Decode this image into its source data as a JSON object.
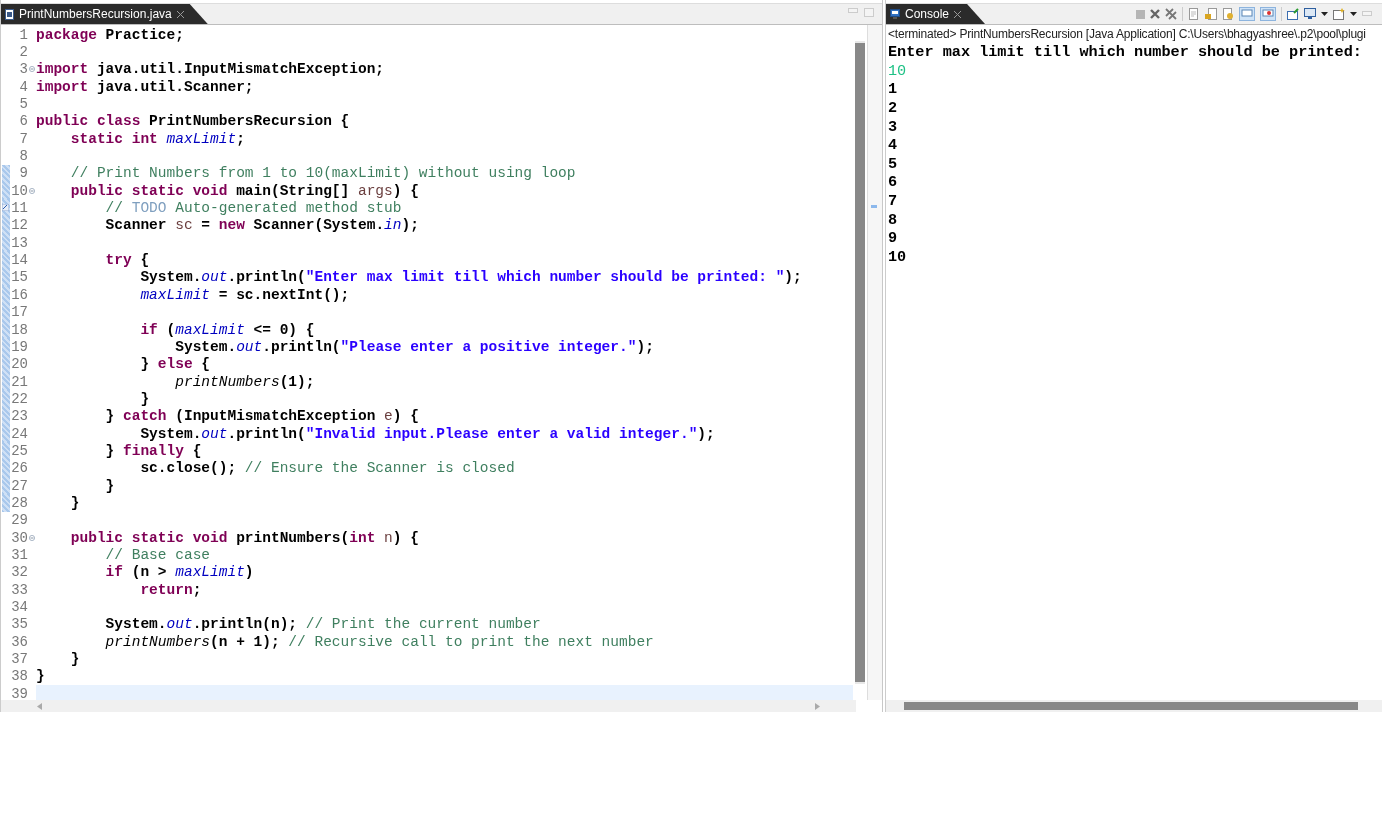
{
  "editor": {
    "tab": {
      "label": "PrintNumbersRecursion.java",
      "selected": true
    },
    "lines": [
      {
        "number": "1",
        "fold": false,
        "changed": false,
        "task": false,
        "current": false,
        "tokens": [
          {
            "kind": "keyword",
            "text": "package"
          },
          {
            "kind": "plain",
            "text": " Practice;"
          }
        ]
      },
      {
        "number": "2",
        "fold": false,
        "changed": false,
        "task": false,
        "current": false
      },
      {
        "number": "3",
        "fold": true,
        "changed": false,
        "task": false,
        "current": false,
        "tokens": [
          {
            "kind": "keyword",
            "text": "import"
          },
          {
            "kind": "plain",
            "text": " java.util.InputMismatchException;"
          }
        ]
      },
      {
        "number": "4",
        "fold": false,
        "changed": false,
        "task": false,
        "current": false,
        "tokens": [
          {
            "kind": "keyword",
            "text": "import"
          },
          {
            "kind": "plain",
            "text": " java.util.Scanner;"
          }
        ]
      },
      {
        "number": "5",
        "fold": false,
        "changed": false,
        "task": false,
        "current": false
      },
      {
        "number": "6",
        "fold": false,
        "changed": false,
        "task": false,
        "current": false,
        "tokens": [
          {
            "kind": "keyword",
            "text": "public class"
          },
          {
            "kind": "plain",
            "text": " PrintNumbersRecursion {"
          }
        ]
      },
      {
        "number": "7",
        "fold": false,
        "changed": false,
        "task": false,
        "current": false,
        "tokens": [
          {
            "kind": "keyword",
            "text": "    static int "
          },
          {
            "kind": "field",
            "text": "maxLimit"
          },
          {
            "kind": "plain",
            "text": ";"
          }
        ]
      },
      {
        "number": "8",
        "fold": false,
        "changed": false,
        "task": false,
        "current": false
      },
      {
        "number": "9",
        "fold": false,
        "changed": true,
        "task": false,
        "current": false,
        "tokens": [
          {
            "kind": "comment",
            "text": "    // Print Numbers from 1 to 10(maxLimit) without using loop"
          }
        ]
      },
      {
        "number": "10",
        "fold": true,
        "changed": true,
        "task": false,
        "current": false,
        "tokens": [
          {
            "kind": "keyword",
            "text": "    public static void"
          },
          {
            "kind": "plain",
            "text": " main(String[] "
          },
          {
            "kind": "local",
            "text": "args"
          },
          {
            "kind": "plain",
            "text": ") {"
          }
        ]
      },
      {
        "number": "11",
        "fold": false,
        "changed": true,
        "task": true,
        "current": false,
        "tokens": [
          {
            "kind": "comment",
            "text": "        // "
          },
          {
            "kind": "todo",
            "text": "TODO"
          },
          {
            "kind": "comment",
            "text": " Auto-generated method stub"
          }
        ]
      },
      {
        "number": "12",
        "fold": false,
        "changed": true,
        "task": false,
        "current": false,
        "tokens": [
          {
            "kind": "plain",
            "text": "        Scanner "
          },
          {
            "kind": "local",
            "text": "sc"
          },
          {
            "kind": "plain",
            "text": " = "
          },
          {
            "kind": "keyword",
            "text": "new"
          },
          {
            "kind": "plain",
            "text": " Scanner(System."
          },
          {
            "kind": "field",
            "text": "in"
          },
          {
            "kind": "plain",
            "text": ");"
          }
        ]
      },
      {
        "number": "13",
        "fold": false,
        "changed": true,
        "task": false,
        "current": false
      },
      {
        "number": "14",
        "fold": false,
        "changed": true,
        "task": false,
        "current": false,
        "tokens": [
          {
            "kind": "keyword",
            "text": "        try"
          },
          {
            "kind": "plain",
            "text": " {"
          }
        ]
      },
      {
        "number": "15",
        "fold": false,
        "changed": true,
        "task": false,
        "current": false,
        "tokens": [
          {
            "kind": "plain",
            "text": "            System."
          },
          {
            "kind": "field",
            "text": "out"
          },
          {
            "kind": "plain",
            "text": ".println("
          },
          {
            "kind": "string",
            "text": "\"Enter max limit till which number should be printed: \""
          },
          {
            "kind": "plain",
            "text": ");"
          }
        ]
      },
      {
        "number": "16",
        "fold": false,
        "changed": true,
        "task": false,
        "current": false,
        "tokens": [
          {
            "kind": "field",
            "text": "            maxLimit"
          },
          {
            "kind": "plain",
            "text": " = sc.nextInt();"
          }
        ]
      },
      {
        "number": "17",
        "fold": false,
        "changed": true,
        "task": false,
        "current": false
      },
      {
        "number": "18",
        "fold": false,
        "changed": true,
        "task": false,
        "current": false,
        "tokens": [
          {
            "kind": "keyword",
            "text": "            if"
          },
          {
            "kind": "plain",
            "text": " ("
          },
          {
            "kind": "field",
            "text": "maxLimit"
          },
          {
            "kind": "plain",
            "text": " <= 0) {"
          }
        ]
      },
      {
        "number": "19",
        "fold": false,
        "changed": true,
        "task": false,
        "current": false,
        "tokens": [
          {
            "kind": "plain",
            "text": "                System."
          },
          {
            "kind": "field",
            "text": "out"
          },
          {
            "kind": "plain",
            "text": ".println("
          },
          {
            "kind": "string",
            "text": "\"Please enter a positive integer.\""
          },
          {
            "kind": "plain",
            "text": ");"
          }
        ]
      },
      {
        "number": "20",
        "fold": false,
        "changed": true,
        "task": false,
        "current": false,
        "tokens": [
          {
            "kind": "plain",
            "text": "            } "
          },
          {
            "kind": "keyword",
            "text": "else"
          },
          {
            "kind": "plain",
            "text": " {"
          }
        ]
      },
      {
        "number": "21",
        "fold": false,
        "changed": true,
        "task": false,
        "current": false,
        "tokens": [
          {
            "kind": "static-method",
            "text": "                printNumbers"
          },
          {
            "kind": "plain",
            "text": "(1);"
          }
        ]
      },
      {
        "number": "22",
        "fold": false,
        "changed": true,
        "task": false,
        "current": false,
        "tokens": [
          {
            "kind": "plain",
            "text": "            }"
          }
        ]
      },
      {
        "number": "23",
        "fold": false,
        "changed": true,
        "task": false,
        "current": false,
        "tokens": [
          {
            "kind": "plain",
            "text": "        } "
          },
          {
            "kind": "keyword",
            "text": "catch"
          },
          {
            "kind": "plain",
            "text": " (InputMismatchException "
          },
          {
            "kind": "local",
            "text": "e"
          },
          {
            "kind": "plain",
            "text": ") {"
          }
        ]
      },
      {
        "number": "24",
        "fold": false,
        "changed": true,
        "task": false,
        "current": false,
        "tokens": [
          {
            "kind": "plain",
            "text": "            System."
          },
          {
            "kind": "field",
            "text": "out"
          },
          {
            "kind": "plain",
            "text": ".println("
          },
          {
            "kind": "string",
            "text": "\"Invalid input.Please enter a valid integer.\""
          },
          {
            "kind": "plain",
            "text": ");"
          }
        ]
      },
      {
        "number": "25",
        "fold": false,
        "changed": true,
        "task": false,
        "current": false,
        "tokens": [
          {
            "kind": "plain",
            "text": "        } "
          },
          {
            "kind": "keyword",
            "text": "finally"
          },
          {
            "kind": "plain",
            "text": " {"
          }
        ]
      },
      {
        "number": "26",
        "fold": false,
        "changed": true,
        "task": false,
        "current": false,
        "tokens": [
          {
            "kind": "plain",
            "text": "            sc.close(); "
          },
          {
            "kind": "comment",
            "text": "// Ensure the Scanner is closed"
          }
        ]
      },
      {
        "number": "27",
        "fold": false,
        "changed": true,
        "task": false,
        "current": false,
        "tokens": [
          {
            "kind": "plain",
            "text": "        }"
          }
        ]
      },
      {
        "number": "28",
        "fold": false,
        "changed": true,
        "task": false,
        "current": false,
        "tokens": [
          {
            "kind": "plain",
            "text": "    }"
          }
        ]
      },
      {
        "number": "29",
        "fold": false,
        "changed": false,
        "task": false,
        "current": false
      },
      {
        "number": "30",
        "fold": true,
        "changed": false,
        "task": false,
        "current": false,
        "tokens": [
          {
            "kind": "keyword",
            "text": "    public static void"
          },
          {
            "kind": "plain",
            "text": " printNumbers("
          },
          {
            "kind": "keyword",
            "text": "int "
          },
          {
            "kind": "local",
            "text": "n"
          },
          {
            "kind": "plain",
            "text": ") {"
          }
        ]
      },
      {
        "number": "31",
        "fold": false,
        "changed": false,
        "task": false,
        "current": false,
        "tokens": [
          {
            "kind": "comment",
            "text": "        // Base case"
          }
        ]
      },
      {
        "number": "32",
        "fold": false,
        "changed": false,
        "task": false,
        "current": false,
        "tokens": [
          {
            "kind": "keyword",
            "text": "        if"
          },
          {
            "kind": "plain",
            "text": " (n > "
          },
          {
            "kind": "field",
            "text": "maxLimit"
          },
          {
            "kind": "plain",
            "text": ")"
          }
        ]
      },
      {
        "number": "33",
        "fold": false,
        "changed": false,
        "task": false,
        "current": false,
        "tokens": [
          {
            "kind": "keyword",
            "text": "            return"
          },
          {
            "kind": "plain",
            "text": ";"
          }
        ]
      },
      {
        "number": "34",
        "fold": false,
        "changed": false,
        "task": false,
        "current": false
      },
      {
        "number": "35",
        "fold": false,
        "changed": false,
        "task": false,
        "current": false,
        "tokens": [
          {
            "kind": "plain",
            "text": "        System."
          },
          {
            "kind": "field",
            "text": "out"
          },
          {
            "kind": "plain",
            "text": ".println(n); "
          },
          {
            "kind": "comment",
            "text": "// Print the current number"
          }
        ]
      },
      {
        "number": "36",
        "fold": false,
        "changed": false,
        "task": false,
        "current": false,
        "tokens": [
          {
            "kind": "static-method",
            "text": "        printNumbers"
          },
          {
            "kind": "plain",
            "text": "(n + 1); "
          },
          {
            "kind": "comment",
            "text": "// Recursive call to print the next number"
          }
        ]
      },
      {
        "number": "37",
        "fold": false,
        "changed": false,
        "task": false,
        "current": false,
        "tokens": [
          {
            "kind": "plain",
            "text": "    }"
          }
        ]
      },
      {
        "number": "38",
        "fold": false,
        "changed": false,
        "task": false,
        "current": false,
        "tokens": [
          {
            "kind": "plain",
            "text": "}"
          }
        ]
      },
      {
        "number": "39",
        "fold": false,
        "changed": false,
        "task": false,
        "current": true
      }
    ]
  },
  "console": {
    "tab": {
      "label": "Console",
      "selected": true
    },
    "header": "<terminated> PrintNumbersRecursion [Java Application] C:\\Users\\bhagyashree\\.p2\\pool\\plugi",
    "output": [
      {
        "kind": "output",
        "text": "Enter max limit till which number should be printed: "
      },
      {
        "kind": "input",
        "text": "10"
      },
      {
        "kind": "output",
        "text": "1"
      },
      {
        "kind": "output",
        "text": "2"
      },
      {
        "kind": "output",
        "text": "3"
      },
      {
        "kind": "output",
        "text": "4"
      },
      {
        "kind": "output",
        "text": "5"
      },
      {
        "kind": "output",
        "text": "6"
      },
      {
        "kind": "output",
        "text": "7"
      },
      {
        "kind": "output",
        "text": "8"
      },
      {
        "kind": "output",
        "text": "9"
      },
      {
        "kind": "output",
        "text": "10"
      }
    ]
  }
}
